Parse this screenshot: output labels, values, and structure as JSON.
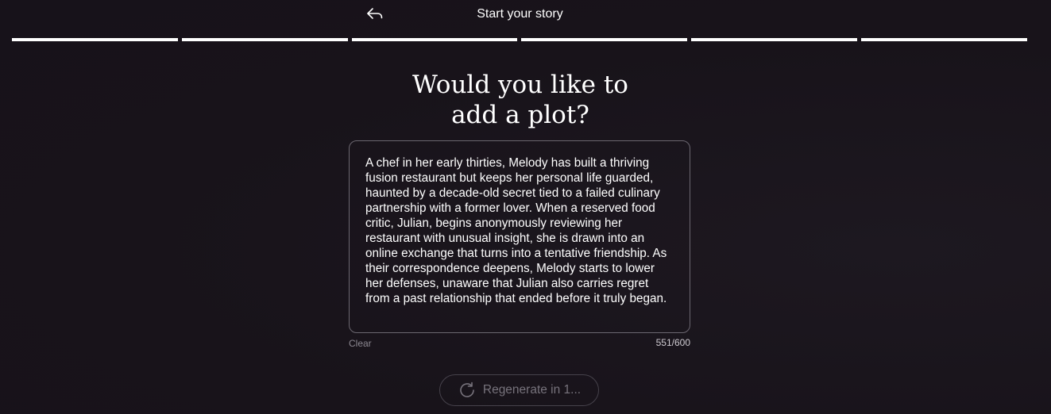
{
  "header": {
    "title": "Start your story",
    "back_icon": "back-arrow-icon"
  },
  "progress": {
    "steps_total": 6,
    "steps_completed": 6
  },
  "question": {
    "line1": "Would you like to",
    "line2": "add a plot?"
  },
  "plot": {
    "value": "A chef in her early thirties, Melody has built a thriving fusion restaurant but keeps her personal life guarded, haunted by a decade-old secret tied to a failed culinary partnership with a former lover. When a reserved food critic, Julian, begins anonymously reviewing her restaurant with unusual insight, she is drawn into an online exchange that turns into a tentative friendship. As their correspondence deepens, Melody starts to lower her defenses, unaware that Julian also carries regret from a past relationship that ended before it truly began.",
    "clear_label": "Clear",
    "char_count": "551/600"
  },
  "regenerate": {
    "label": "Regenerate in 1...",
    "icon": "refresh-icon"
  },
  "colors": {
    "background": "#19141a",
    "text": "#ffffff",
    "muted": "#8c8891",
    "border": "#6b6770"
  }
}
